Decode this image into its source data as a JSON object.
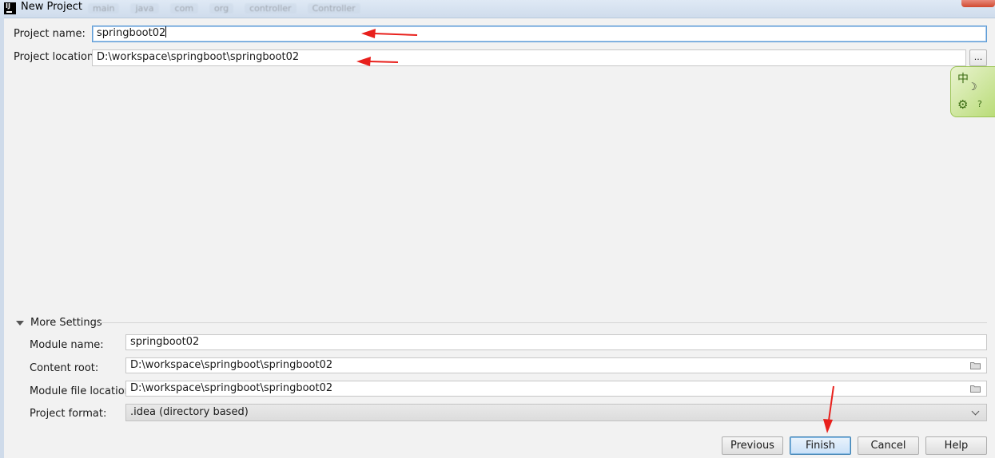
{
  "window": {
    "title": "New Project",
    "app_icon_text": "IJ",
    "background_tabs": [
      "main",
      "java",
      "com",
      "org",
      "controller",
      "Controller"
    ]
  },
  "form": {
    "project_name_label": "Project name:",
    "project_name_value": "springboot02",
    "project_location_label": "Project location:",
    "project_location_value": "D:\\workspace\\springboot\\springboot02",
    "browse_label": "..."
  },
  "ime": {
    "char": "中",
    "moon": "☽",
    "gear": "⚙",
    "help": "?"
  },
  "more_settings": {
    "header": "More Settings",
    "module_name_label": "Module name:",
    "module_name_value": "springboot02",
    "content_root_label": "Content root:",
    "content_root_value": "D:\\workspace\\springboot\\springboot02",
    "module_file_location_label": "Module file location:",
    "module_file_location_value": "D:\\workspace\\springboot\\springboot02",
    "project_format_label": "Project format:",
    "project_format_value": ".idea (directory based)"
  },
  "buttons": {
    "previous": "Previous",
    "finish": "Finish",
    "cancel": "Cancel",
    "help": "Help"
  },
  "colors": {
    "annotation_arrow": "#e8201c",
    "focus_border": "#5b9bd5",
    "dialog_bg": "#f2f2f2"
  },
  "icons": {
    "folder": "folder-icon",
    "dropdown": "chevron-down-icon",
    "expand": "triangle-down-icon"
  }
}
